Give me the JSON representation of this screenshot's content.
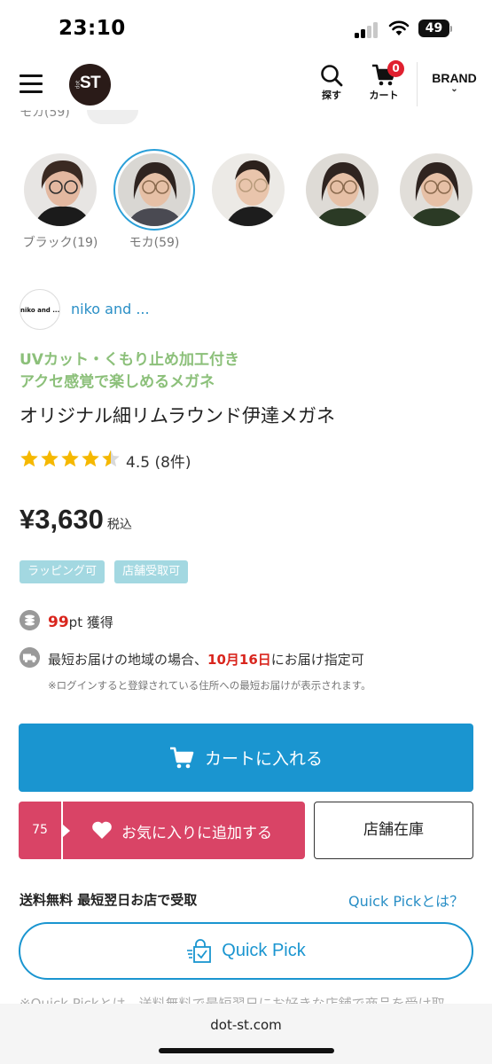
{
  "status_bar": {
    "time": "23:10",
    "battery": "49"
  },
  "header": {
    "logo_text": "ST",
    "logo_small": "dot",
    "search_label": "探す",
    "cart_label": "カート",
    "cart_count": "0",
    "brand_label": "BRAND",
    "brand_chevron": "⌄"
  },
  "prev_row_clipped": {
    "text": "モカ(59)"
  },
  "colors": [
    {
      "label": "ブラック(19)",
      "selected": false,
      "frame_color": "#2b2b2b"
    },
    {
      "label": "モカ(59)",
      "selected": true,
      "frame_color": "#8a6a4e"
    },
    {
      "label": "",
      "selected": false,
      "frame_color": "#b79a7a"
    },
    {
      "label": "",
      "selected": false,
      "frame_color": "#8a6a4e"
    },
    {
      "label": "",
      "selected": false,
      "frame_color": "#8a6a4e"
    }
  ],
  "brand": {
    "logo_text": "niko and ...",
    "name": "niko and ..."
  },
  "product": {
    "catch_line1": "UVカット・くもり止め加工付き",
    "catch_line2": "アクセ感覚で楽しめるメガネ",
    "title": "オリジナル細リムラウンド伊達メガネ",
    "rating_value": 4.5,
    "rating_text": "4.5 (8件)",
    "price": "¥3,630",
    "tax_label": "税込",
    "tags": [
      "ラッピング可",
      "店舗受取可"
    ]
  },
  "points": {
    "value": "99",
    "suffix": "pt 獲得"
  },
  "delivery": {
    "prefix": "最短お届けの地域の場合、",
    "date": "10月16日",
    "suffix": "にお届け指定可",
    "note": "※ログインすると登録されている住所への最短お届けが表示されます。"
  },
  "actions": {
    "cart_button": "カートに入れる",
    "fav_count": "75",
    "fav_button": "お気に入りに追加する",
    "store_stock_button": "店舗在庫"
  },
  "quick_pick": {
    "shipping_label": "送料無料 最短翌日お店で受取",
    "about_link": "Quick Pickとは？",
    "button_label": "Quick Pick",
    "clipped_note": "※Quick Pickとは、送料無料で最短翌日にお好きな店舗で商品を受け取"
  },
  "browser": {
    "url": "dot-st.com"
  },
  "theme": {
    "accent_blue": "#1a95d0",
    "link_blue": "#2a8fc6",
    "favorite_pink": "#d94466",
    "catch_green": "#8cc07a",
    "tag_bg": "#a3d8e1",
    "alert_red": "#d9251d"
  }
}
